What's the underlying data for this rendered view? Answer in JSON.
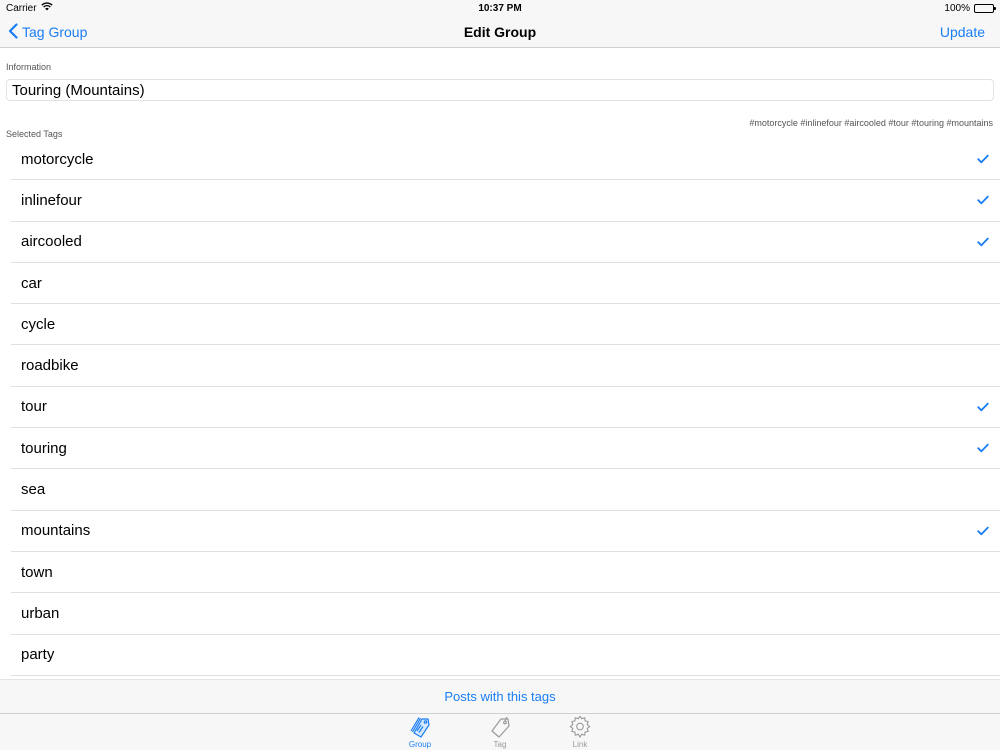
{
  "status_bar": {
    "carrier": "Carrier",
    "time": "10:37 PM",
    "battery": "100%"
  },
  "nav": {
    "back_label": "Tag Group",
    "title": "Edit Group",
    "update_label": "Update"
  },
  "information": {
    "label": "Information",
    "value": "Touring (Mountains)"
  },
  "selected_tags": {
    "label": "Selected Tags",
    "summary": "#motorcycle #inlinefour #aircooled #tour #touring #mountains"
  },
  "tags": [
    {
      "label": "motorcycle",
      "checked": true
    },
    {
      "label": "inlinefour",
      "checked": true
    },
    {
      "label": "aircooled",
      "checked": true
    },
    {
      "label": "car",
      "checked": false
    },
    {
      "label": "cycle",
      "checked": false
    },
    {
      "label": "roadbike",
      "checked": false
    },
    {
      "label": "tour",
      "checked": true
    },
    {
      "label": "touring",
      "checked": true
    },
    {
      "label": "sea",
      "checked": false
    },
    {
      "label": "mountains",
      "checked": true
    },
    {
      "label": "town",
      "checked": false
    },
    {
      "label": "urban",
      "checked": false
    },
    {
      "label": "party",
      "checked": false
    }
  ],
  "posts_link": "Posts with this tags",
  "tabs": [
    {
      "label": "Group",
      "icon": "tags-icon",
      "active": true
    },
    {
      "label": "Tag",
      "icon": "tag-icon",
      "active": false
    },
    {
      "label": "Link",
      "icon": "gear-icon",
      "active": false
    }
  ],
  "colors": {
    "accent": "#1a7ef5",
    "inactive": "#9a9a9a"
  }
}
